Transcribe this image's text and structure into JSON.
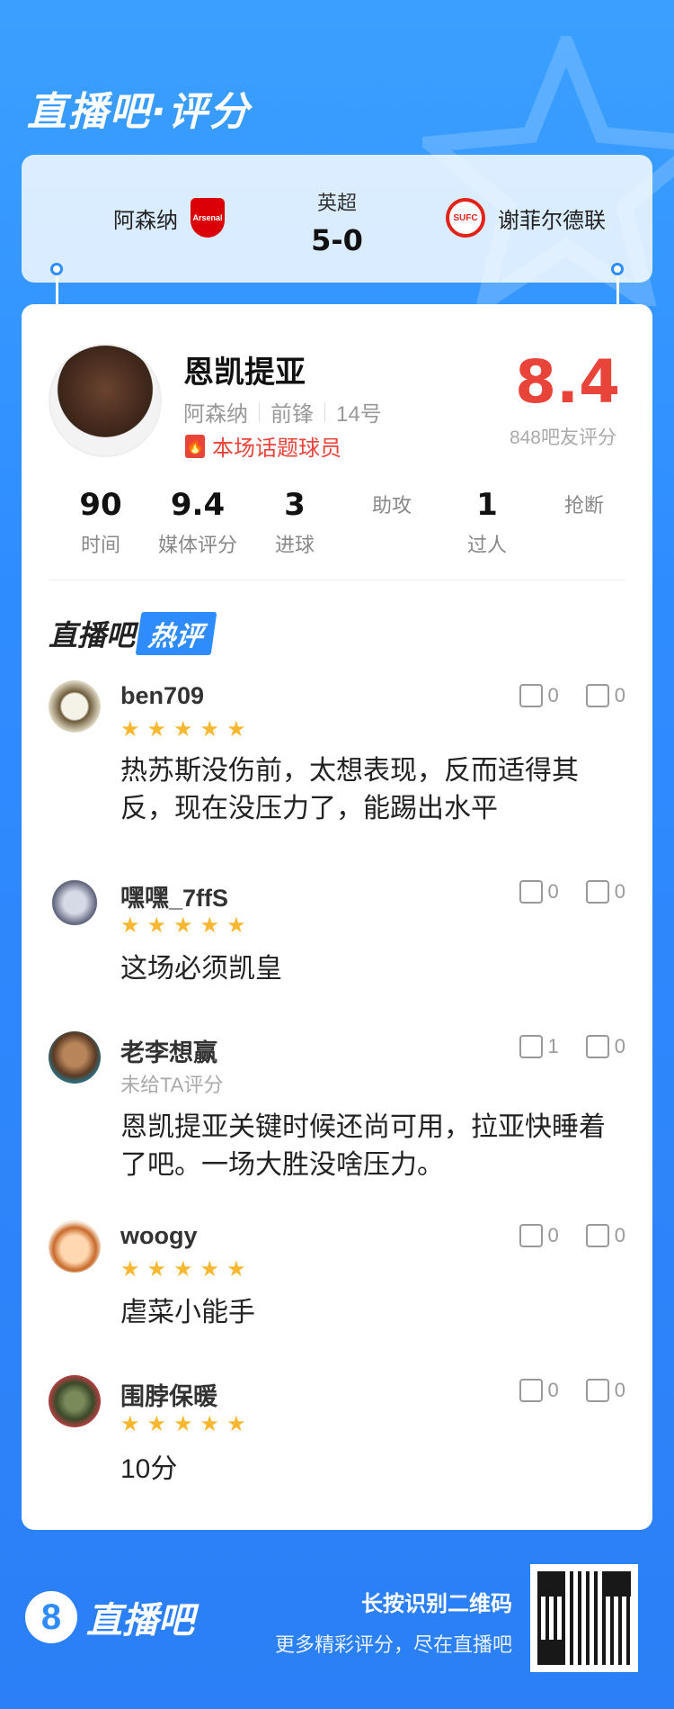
{
  "header": {
    "brand_title": "直播吧·评分"
  },
  "match": {
    "league": "英超",
    "score": "5-0",
    "home_team": "阿森纳",
    "away_team": "谢菲尔德联",
    "home_crest_text": "Arsenal",
    "away_crest_text": "SUFC"
  },
  "player": {
    "name": "恩凯提亚",
    "team": "阿森纳",
    "position": "前锋",
    "number": "14号",
    "hot_tag": "本场话题球员",
    "rating": "8.4",
    "rating_sub": "848吧友评分"
  },
  "stats": [
    {
      "value": "90",
      "label": "时间"
    },
    {
      "value": "9.4",
      "label": "媒体评分"
    },
    {
      "value": "3",
      "label": "进球"
    },
    {
      "value": "",
      "label": "助攻"
    },
    {
      "value": "1",
      "label": "过人"
    },
    {
      "value": "",
      "label": "抢断"
    }
  ],
  "hot_comments": {
    "title_left": "直播吧",
    "title_right": "热评"
  },
  "comments": [
    {
      "user": "ben709",
      "stars": "★★★★★",
      "sub": "",
      "text": "热苏斯没伤前，太想表现，反而适得其反，现在没压力了，能踢出水平",
      "likes": "0",
      "dislikes": "0"
    },
    {
      "user": "嘿嘿_7ffS",
      "stars": "★★★★★",
      "sub": "",
      "text": "这场必须凯皇",
      "likes": "0",
      "dislikes": "0"
    },
    {
      "user": "老李想赢",
      "stars": "",
      "sub": "未给TA评分",
      "text": "恩凯提亚关键时候还尚可用，拉亚快睡着了吧。一场大胜没啥压力。",
      "likes": "1",
      "dislikes": "0"
    },
    {
      "user": "woogy",
      "stars": "★★★★★",
      "sub": "",
      "text": "虐菜小能手",
      "likes": "0",
      "dislikes": "0"
    },
    {
      "user": "围脖保暖",
      "stars": "★★★★★",
      "sub": "",
      "text": "10分",
      "likes": "0",
      "dislikes": "0"
    }
  ],
  "footer": {
    "logo_mark": "8",
    "logo_text": "直播吧",
    "line1": "长按识别二维码",
    "line2": "更多精彩评分，尽在直播吧"
  },
  "colors": {
    "accent": "#2f8cff",
    "rating": "#e8443a",
    "star": "#f7b731"
  }
}
